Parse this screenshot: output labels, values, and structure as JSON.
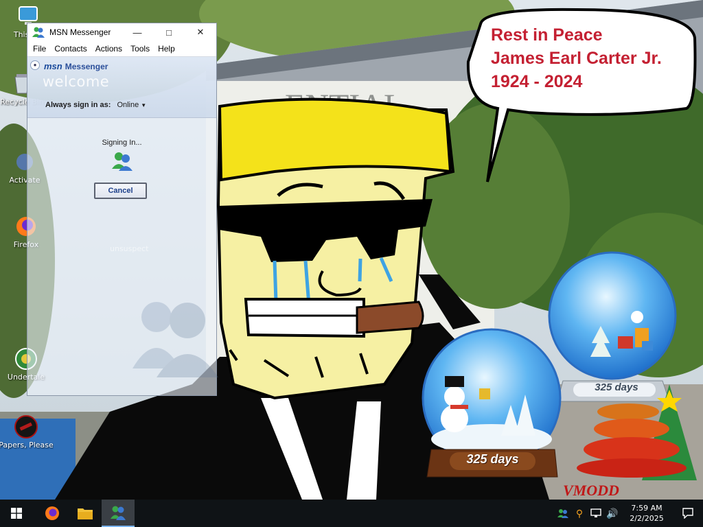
{
  "desktop_icons": [
    {
      "label": "This PC"
    },
    {
      "label": "Recycle Bin"
    },
    {
      "label": "Activate"
    },
    {
      "label": "Firefox"
    },
    {
      "label": "Undertale"
    },
    {
      "label": "Papers, Please"
    }
  ],
  "behind_window_label": "unsuspect",
  "msn": {
    "title": "MSN Messenger",
    "menu": [
      "File",
      "Contacts",
      "Actions",
      "Tools",
      "Help"
    ],
    "logo_msn": "msn",
    "logo_messenger": "Messenger",
    "welcome": "welcome",
    "signin_label": "Always sign in as:",
    "signin_status": "Online",
    "signing_text": "Signing In...",
    "cancel_label": "Cancel"
  },
  "bubble": {
    "line1": "Rest in Peace",
    "line2": "James Earl Carter Jr.",
    "line3": "1924 - 2024"
  },
  "building_sign": "ENTIAL",
  "globes": {
    "left_label": "325 days",
    "right_label": "325 days"
  },
  "watermark": "VMODD",
  "taskbar": {
    "time": "7:59 AM",
    "date": "2/2/2025"
  },
  "colors": {
    "bubble_text": "#c42032",
    "taskbar": "#0f1316",
    "face": "#f6f0a3",
    "hair": "#f4e21a"
  }
}
